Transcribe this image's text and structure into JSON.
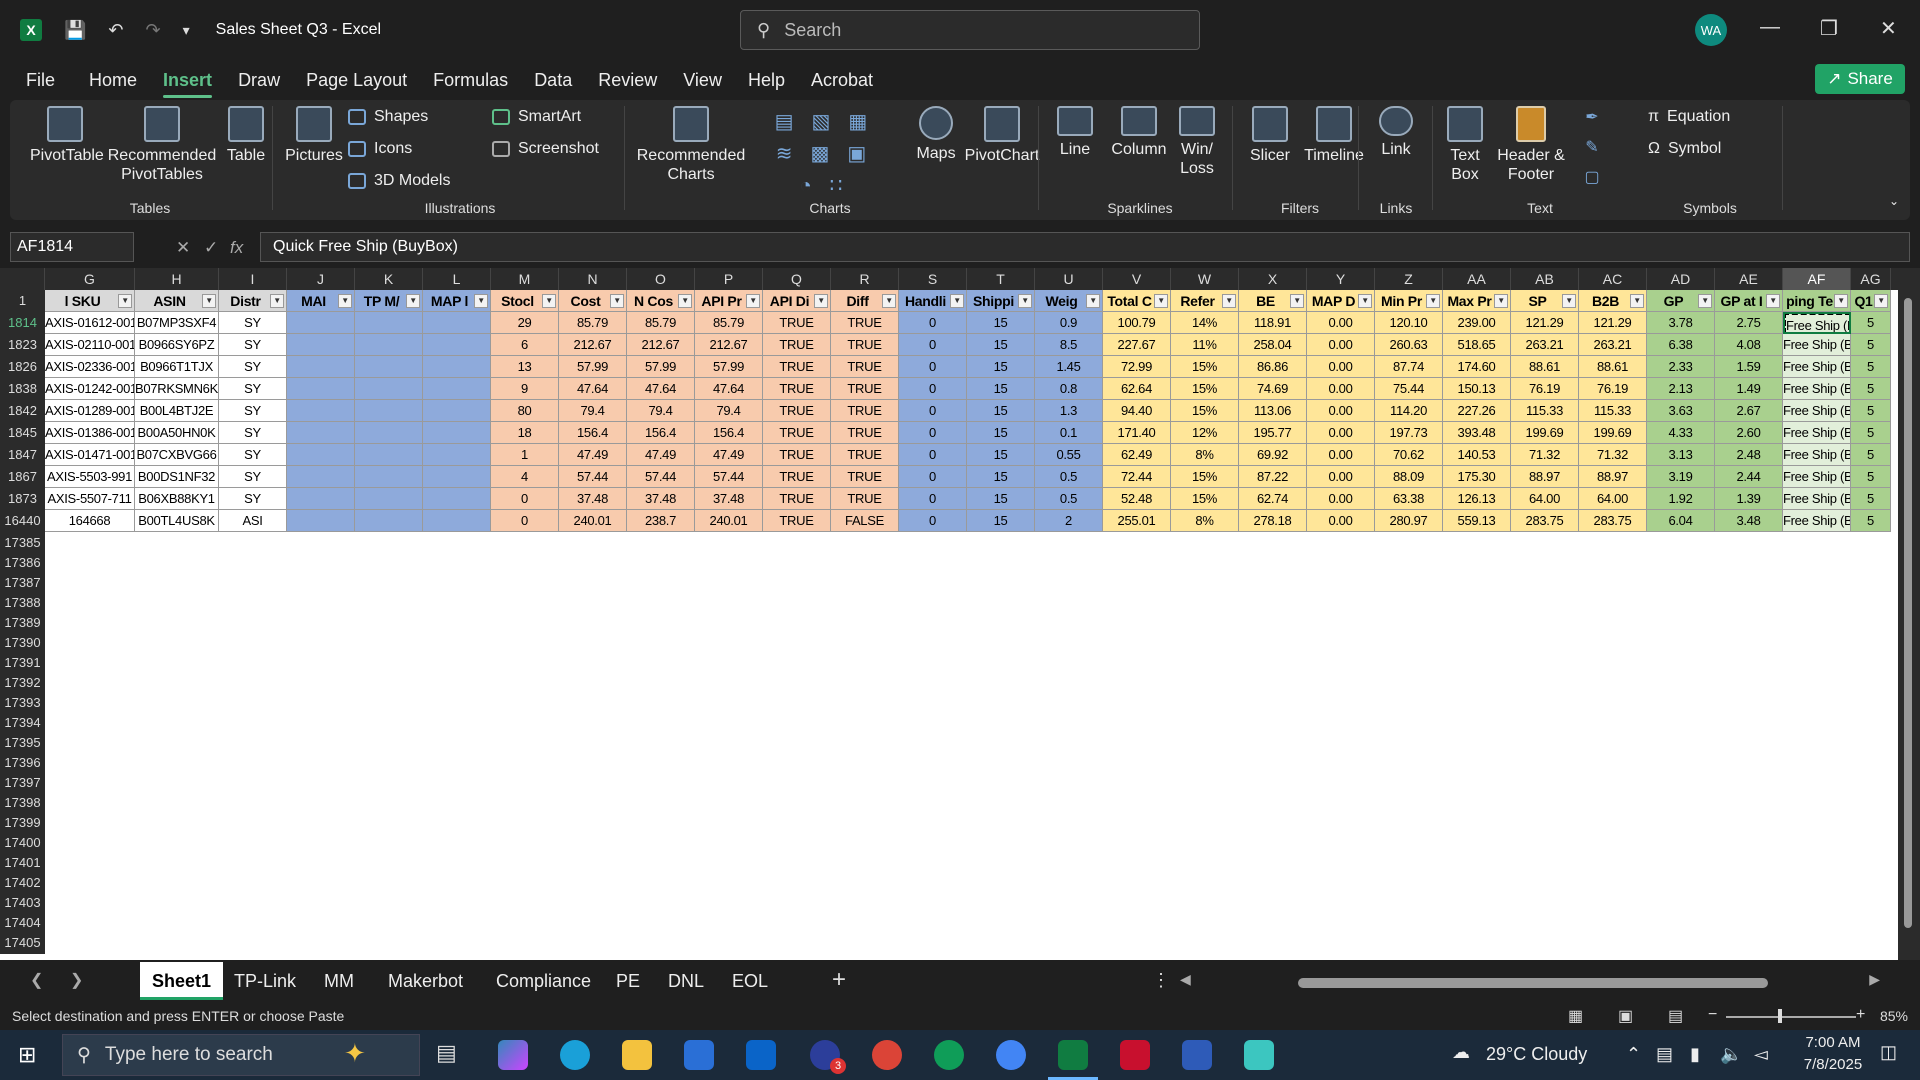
{
  "window": {
    "title": "Sales Sheet Q3 - Excel",
    "search_placeholder": "Search",
    "avatar": "WA"
  },
  "menu": [
    "File",
    "Home",
    "Insert",
    "Draw",
    "Page Layout",
    "Formulas",
    "Data",
    "Review",
    "View",
    "Help",
    "Acrobat"
  ],
  "share_label": "Share",
  "ribbon": {
    "tables": {
      "pivottable": "PivotTable",
      "recommended": "Recommended PivotTables",
      "table": "Table",
      "label": "Tables"
    },
    "illustrations": {
      "pictures": "Pictures",
      "shapes": "Shapes",
      "icons": "Icons",
      "models": "3D Models",
      "smartart": "SmartArt",
      "screenshot": "Screenshot",
      "label": "Illustrations"
    },
    "charts": {
      "recommended": "Recommended Charts",
      "maps": "Maps",
      "pivotchart": "PivotChart",
      "label": "Charts"
    },
    "sparklines": {
      "line": "Line",
      "column": "Column",
      "winloss": "Win/ Loss",
      "label": "Sparklines"
    },
    "filters": {
      "slicer": "Slicer",
      "timeline": "Timeline",
      "label": "Filters"
    },
    "links": {
      "link": "Link",
      "label": "Links"
    },
    "text": {
      "textbox": "Text Box",
      "header": "Header & Footer",
      "label": "Text"
    },
    "symbols": {
      "equation": "Equation",
      "symbol": "Symbol",
      "label": "Symbols"
    }
  },
  "formula_bar": {
    "name_box": "AF1814",
    "content": "Quick Free Ship (BuyBox)"
  },
  "columns": [
    "G",
    "H",
    "I",
    "J",
    "K",
    "L",
    "M",
    "N",
    "O",
    "P",
    "Q",
    "R",
    "S",
    "T",
    "U",
    "V",
    "W",
    "X",
    "Y",
    "Z",
    "AA",
    "AB",
    "AC",
    "AD",
    "AE",
    "AF",
    "AG"
  ],
  "headers": [
    "l SKU",
    "ASIN",
    "Distr",
    "MAI",
    "TP M/",
    "MAP l",
    "Stocl",
    "Cost",
    "N Cos",
    "API Pr",
    "API Di",
    "Diff",
    "Handli",
    "Shippi",
    "Weig",
    "Total C",
    "Refer",
    "BE",
    "MAP D",
    "Min Pr",
    "Max Pr",
    "SP",
    "B2B",
    "GP",
    "GP at I",
    "ping Te",
    "Q1"
  ],
  "rows": [
    {
      "num": "1814",
      "cells": [
        "AXIS-01612-001",
        "B07MP3SXF4",
        "SY",
        "",
        "",
        "",
        "29",
        "85.79",
        "85.79",
        "85.79",
        "TRUE",
        "TRUE",
        "0",
        "15",
        "0.9",
        "100.79",
        "14%",
        "118.91",
        "0.00",
        "120.10",
        "239.00",
        "121.29",
        "121.29",
        "3.78",
        "2.75",
        "Free Ship (B",
        "5"
      ]
    },
    {
      "num": "1823",
      "cells": [
        "AXIS-02110-001",
        "B0966SY6PZ",
        "SY",
        "",
        "",
        "",
        "6",
        "212.67",
        "212.67",
        "212.67",
        "TRUE",
        "TRUE",
        "0",
        "15",
        "8.5",
        "227.67",
        "11%",
        "258.04",
        "0.00",
        "260.63",
        "518.65",
        "263.21",
        "263.21",
        "6.38",
        "4.08",
        "Free Ship (B",
        "5"
      ]
    },
    {
      "num": "1826",
      "cells": [
        "AXIS-02336-001",
        "B0966T1TJX",
        "SY",
        "",
        "",
        "",
        "13",
        "57.99",
        "57.99",
        "57.99",
        "TRUE",
        "TRUE",
        "0",
        "15",
        "1.45",
        "72.99",
        "15%",
        "86.86",
        "0.00",
        "87.74",
        "174.60",
        "88.61",
        "88.61",
        "2.33",
        "1.59",
        "Free Ship (B",
        "5"
      ]
    },
    {
      "num": "1838",
      "cells": [
        "AXIS-01242-001",
        "B07RKSMN6K",
        "SY",
        "",
        "",
        "",
        "9",
        "47.64",
        "47.64",
        "47.64",
        "TRUE",
        "TRUE",
        "0",
        "15",
        "0.8",
        "62.64",
        "15%",
        "74.69",
        "0.00",
        "75.44",
        "150.13",
        "76.19",
        "76.19",
        "2.13",
        "1.49",
        "Free Ship (B",
        "5"
      ]
    },
    {
      "num": "1842",
      "cells": [
        "AXIS-01289-001",
        "B00L4BTJ2E",
        "SY",
        "",
        "",
        "",
        "80",
        "79.4",
        "79.4",
        "79.4",
        "TRUE",
        "TRUE",
        "0",
        "15",
        "1.3",
        "94.40",
        "15%",
        "113.06",
        "0.00",
        "114.20",
        "227.26",
        "115.33",
        "115.33",
        "3.63",
        "2.67",
        "Free Ship (B",
        "5"
      ]
    },
    {
      "num": "1845",
      "cells": [
        "AXIS-01386-001",
        "B00A50HN0K",
        "SY",
        "",
        "",
        "",
        "18",
        "156.4",
        "156.4",
        "156.4",
        "TRUE",
        "TRUE",
        "0",
        "15",
        "0.1",
        "171.40",
        "12%",
        "195.77",
        "0.00",
        "197.73",
        "393.48",
        "199.69",
        "199.69",
        "4.33",
        "2.60",
        "Free Ship (B",
        "5"
      ]
    },
    {
      "num": "1847",
      "cells": [
        "AXIS-01471-001",
        "B07CXBVG66",
        "SY",
        "",
        "",
        "",
        "1",
        "47.49",
        "47.49",
        "47.49",
        "TRUE",
        "TRUE",
        "0",
        "15",
        "0.55",
        "62.49",
        "8%",
        "69.92",
        "0.00",
        "70.62",
        "140.53",
        "71.32",
        "71.32",
        "3.13",
        "2.48",
        "Free Ship (B",
        "5"
      ]
    },
    {
      "num": "1867",
      "cells": [
        "AXIS-5503-991",
        "B00DS1NF32",
        "SY",
        "",
        "",
        "",
        "4",
        "57.44",
        "57.44",
        "57.44",
        "TRUE",
        "TRUE",
        "0",
        "15",
        "0.5",
        "72.44",
        "15%",
        "87.22",
        "0.00",
        "88.09",
        "175.30",
        "88.97",
        "88.97",
        "3.19",
        "2.44",
        "Free Ship (B",
        "5"
      ]
    },
    {
      "num": "1873",
      "cells": [
        "AXIS-5507-711",
        "B06XB88KY1",
        "SY",
        "",
        "",
        "",
        "0",
        "37.48",
        "37.48",
        "37.48",
        "TRUE",
        "TRUE",
        "0",
        "15",
        "0.5",
        "52.48",
        "15%",
        "62.74",
        "0.00",
        "63.38",
        "126.13",
        "64.00",
        "64.00",
        "1.92",
        "1.39",
        "Free Ship (B",
        "5"
      ]
    },
    {
      "num": "16440",
      "cells": [
        "164668",
        "B00TL4US8K",
        "ASI",
        "",
        "",
        "",
        "0",
        "240.01",
        "238.7",
        "240.01",
        "TRUE",
        "FALSE",
        "0",
        "15",
        "2",
        "255.01",
        "8%",
        "278.18",
        "0.00",
        "280.97",
        "559.13",
        "283.75",
        "283.75",
        "6.04",
        "3.48",
        "Free Ship (B",
        "5"
      ]
    }
  ],
  "empty_rows": [
    "17385",
    "17386",
    "17387",
    "17388",
    "17389",
    "17390",
    "17391",
    "17392",
    "17393",
    "17394",
    "17395",
    "17396",
    "17397",
    "17398",
    "17399",
    "17400",
    "17401",
    "17402",
    "17403",
    "17404",
    "17405"
  ],
  "sheet_tabs": [
    "Sheet1",
    "TP-Link",
    "MM",
    "Makerbot",
    "Compliance",
    "PE",
    "DNL",
    "EOL"
  ],
  "status": {
    "message": "Select destination and press ENTER or choose Paste",
    "zoom": "85%"
  },
  "taskbar": {
    "search": "Type here to search",
    "weather": "29°C Cloudy",
    "time": "7:00 AM",
    "date": "7/8/2025",
    "badge": "3"
  },
  "colors": {
    "blue_fill": "#8eaadb",
    "peach_fill": "#f8cbad",
    "yellow_fill": "#ffe699",
    "green_fill": "#a9d08e",
    "accent": "#21a366"
  }
}
